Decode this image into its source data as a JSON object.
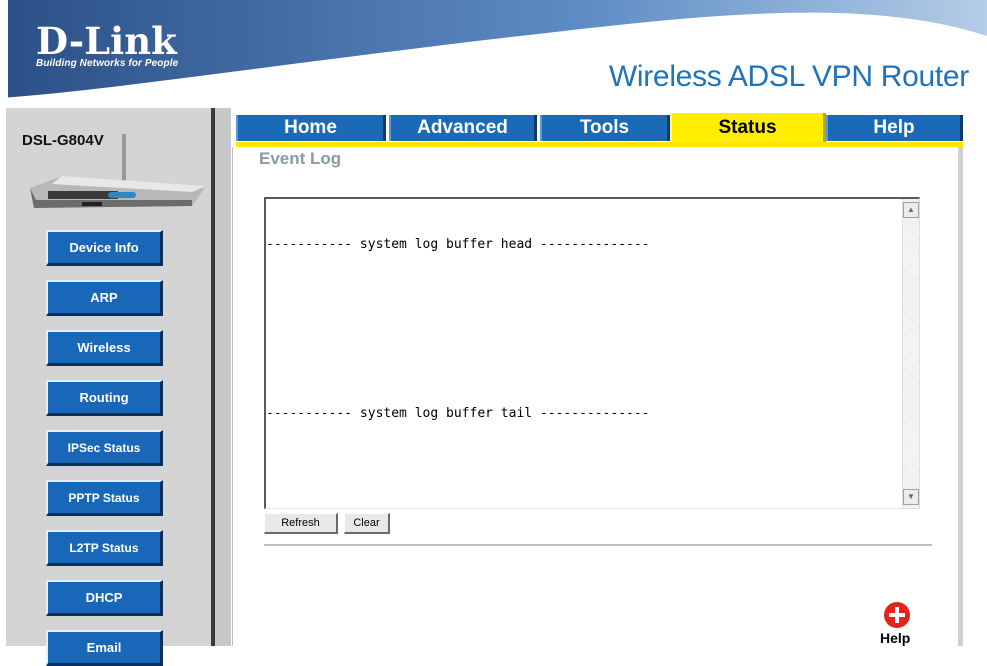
{
  "header": {
    "logo": "D-Link",
    "tagline": "Building Networks for People",
    "product": "Wireless ADSL VPN Router"
  },
  "sidebar": {
    "model": "DSL-G804V",
    "items": [
      {
        "label": "Device Info"
      },
      {
        "label": "ARP"
      },
      {
        "label": "Wireless"
      },
      {
        "label": "Routing"
      },
      {
        "label": "IPSec Status"
      },
      {
        "label": "PPTP Status"
      },
      {
        "label": "L2TP Status"
      },
      {
        "label": "DHCP"
      },
      {
        "label": "Email"
      }
    ]
  },
  "tabs": [
    {
      "label": "Home",
      "active": false
    },
    {
      "label": "Advanced",
      "active": false
    },
    {
      "label": "Tools",
      "active": false
    },
    {
      "label": "Status",
      "active": true
    },
    {
      "label": "Help",
      "active": false
    }
  ],
  "main": {
    "title": "Event Log",
    "log_head": "----------- system log buffer head --------------",
    "log_tail": "----------- system log buffer tail --------------",
    "refresh_label": "Refresh",
    "clear_label": "Clear",
    "help_label": "Help"
  },
  "colors": {
    "brand_blue": "#1b6ab8",
    "active_tab": "#ffee00",
    "title_blue": "#1f74b8"
  }
}
